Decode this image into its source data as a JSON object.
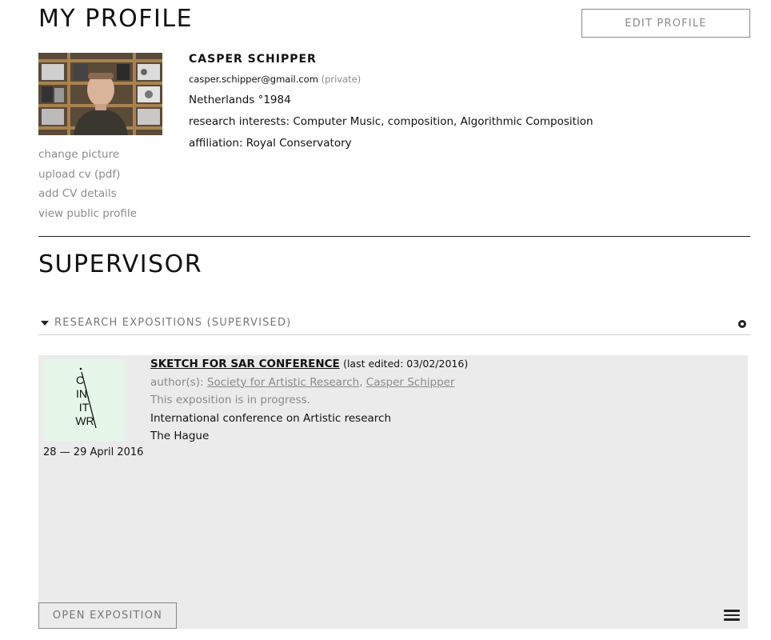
{
  "header": {
    "title": "MY PROFILE",
    "edit_button": "EDIT PROFILE"
  },
  "profile": {
    "name": "CASPER SCHIPPER",
    "email": "casper.schipper@gmail.com",
    "email_visibility": "(private)",
    "country_born": "Netherlands °1984",
    "research_interests": "research interests: Computer Music, composition, Algorithmic Composition",
    "affiliation": "affiliation: Royal Conservatory"
  },
  "side_links": [
    "change picture",
    "upload cv (pdf)",
    "add CV details",
    "view public profile"
  ],
  "supervisor": {
    "title": "SUPERVISOR",
    "expositions_header": "RESEARCH EXPOSITIONS (SUPERVISED)"
  },
  "exposition": {
    "title": "SKETCH FOR SAR CONFERENCE",
    "last_edited": "(last edited: 03/02/2016)",
    "authors_label": "author(s): ",
    "authors": [
      "Society for Artistic Research",
      "Casper Schipper"
    ],
    "author_separator": ", ",
    "status": "This exposition is in progress.",
    "description": "International conference on Artistic research",
    "location": "The Hague",
    "date": "28 — 29 April 2016",
    "thumbnail_text": [
      "C",
      "IN",
      "IT",
      "WR"
    ],
    "open_button": "OPEN EXPOSITION"
  },
  "icons": {
    "collapse": "triangle-down-icon",
    "settings": "settings-dot-icon",
    "menu": "hamburger-menu-icon"
  },
  "colors": {
    "text": "#111111",
    "muted": "#8a8a8a",
    "card_bg": "#ebebeb",
    "thumb_bg": "#e6f7e9"
  }
}
